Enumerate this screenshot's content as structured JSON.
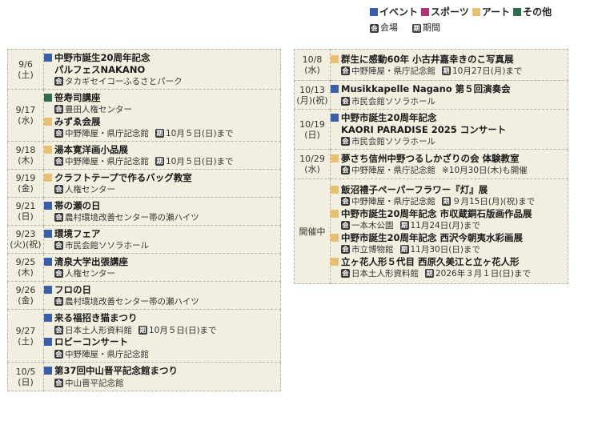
{
  "legend": {
    "categories": [
      {
        "label": "イベント",
        "color": "#3a5fa8"
      },
      {
        "label": "スポーツ",
        "color": "#b0337a"
      },
      {
        "label": "アート",
        "color": "#e8c071"
      },
      {
        "label": "その他",
        "color": "#2e6b4f"
      }
    ],
    "venue_label": "会場",
    "period_label": "期間",
    "venue_icon": "venue-icon",
    "period_icon": "period-icon",
    "venue_glyph": "会",
    "period_glyph": "期"
  },
  "colors": {
    "event": "#3a5fa8",
    "sports": "#b0337a",
    "art": "#e8c071",
    "other": "#2e6b4f",
    "table_bg": "#f2efe1"
  },
  "left": [
    {
      "date": "9/6",
      "dow": "(土)",
      "items": [
        {
          "cat": "event",
          "title": "中野市誕生20周年記念",
          "title2": "パルフェスNAKANO",
          "venue": "タカギセイコーふるさとパーク",
          "period": ""
        }
      ]
    },
    {
      "date": "9/17",
      "dow": "(水)",
      "items": [
        {
          "cat": "other",
          "title": "笹寿司講座",
          "venue": "豊田人権センター",
          "period": ""
        },
        {
          "cat": "art",
          "title": "みずゑ会展",
          "venue": "中野陣屋・県庁記念館",
          "period": "10月５日(日)まで"
        }
      ]
    },
    {
      "date": "9/18",
      "dow": "(木)",
      "items": [
        {
          "cat": "art",
          "title": "湯本寛洋画小品展",
          "venue": "中野陣屋・県庁記念館",
          "period": "10月５日(日)まで"
        }
      ]
    },
    {
      "date": "9/19",
      "dow": "(金)",
      "items": [
        {
          "cat": "art",
          "title": "クラフトテープで作るバッグ教室",
          "venue": "人権センター",
          "period": ""
        }
      ]
    },
    {
      "date": "9/21",
      "dow": "(日)",
      "items": [
        {
          "cat": "event",
          "title": "帯の瀬の日",
          "venue": "農村環境改善センター帯の瀬ハイツ",
          "period": ""
        }
      ]
    },
    {
      "date": "9/23",
      "dow": "(火)(祝)",
      "items": [
        {
          "cat": "event",
          "title": "環境フェア",
          "venue": "市民会館ソソラホール",
          "period": ""
        }
      ]
    },
    {
      "date": "9/25",
      "dow": "(木)",
      "items": [
        {
          "cat": "event",
          "title": "清泉大学出張講座",
          "venue": "人権センター",
          "period": ""
        }
      ]
    },
    {
      "date": "9/26",
      "dow": "(金)",
      "items": [
        {
          "cat": "event",
          "title": "フロの日",
          "venue": "農村環境改善センター帯の瀬ハイツ",
          "period": ""
        }
      ]
    },
    {
      "date": "9/27",
      "dow": "(土)",
      "items": [
        {
          "cat": "event",
          "title": "来る福招き猫まつり",
          "venue": "日本土人形資料館",
          "period": "10月５日(日)まで"
        },
        {
          "cat": "event",
          "title": "ロビーコンサート",
          "venue": "中野陣屋・県庁記念館",
          "period": ""
        }
      ]
    },
    {
      "date": "10/5",
      "dow": "(日)",
      "items": [
        {
          "cat": "event",
          "title": "第37回中山晋平記念館まつり",
          "venue": "中山晋平記念館",
          "period": ""
        }
      ]
    }
  ],
  "right": [
    {
      "date": "10/8",
      "dow": "(水)",
      "items": [
        {
          "cat": "art",
          "title": "群生に感動60年 小古井嘉幸きのこ写真展",
          "venue": "中野陣屋・県庁記念館",
          "period": "10月27日(月)まで"
        }
      ]
    },
    {
      "date": "10/13",
      "dow": "(月)(祝)",
      "items": [
        {
          "cat": "event",
          "title": "Musikkapelle Nagano 第５回演奏会",
          "venue": "市民会館ソソラホール",
          "period": ""
        }
      ]
    },
    {
      "date": "10/19",
      "dow": "(日)",
      "items": [
        {
          "cat": "event",
          "title": "中野市誕生20周年記念",
          "title2": "KAORI PARADISE 2025 コンサート",
          "venue": "市民会館ソソラホール",
          "period": ""
        }
      ]
    },
    {
      "date": "10/29",
      "dow": "(水)",
      "items": [
        {
          "cat": "art",
          "title": "夢さち信州中野つるしかざりの会 体験教室",
          "venue": "中野陣屋・県庁記念館",
          "note": "※10月30日(木)も開催",
          "period": ""
        }
      ]
    },
    {
      "date": "開催中",
      "dow": "",
      "items": [
        {
          "cat": "art",
          "title": "飯沼禮子ペーパーフラワー『灯』展",
          "venue": "中野陣屋・県庁記念館",
          "period": "９月15日(月)(祝)まで"
        },
        {
          "cat": "art",
          "title": "中野市誕生20周年記念 市収蔵銅石版画作品展",
          "venue": "一本木公園",
          "period": "11月24日(月)まで"
        },
        {
          "cat": "art",
          "title": "中野市誕生20周年記念 西沢今朝夷水彩画展",
          "venue": "市立博物館",
          "period": "11月30日(日)まで"
        },
        {
          "cat": "art",
          "title": "立ヶ花人形５代目 西原久美江と立ヶ花人形",
          "venue": "日本土人形資料館",
          "period": "2026年３月１日(日)まで"
        }
      ]
    }
  ]
}
